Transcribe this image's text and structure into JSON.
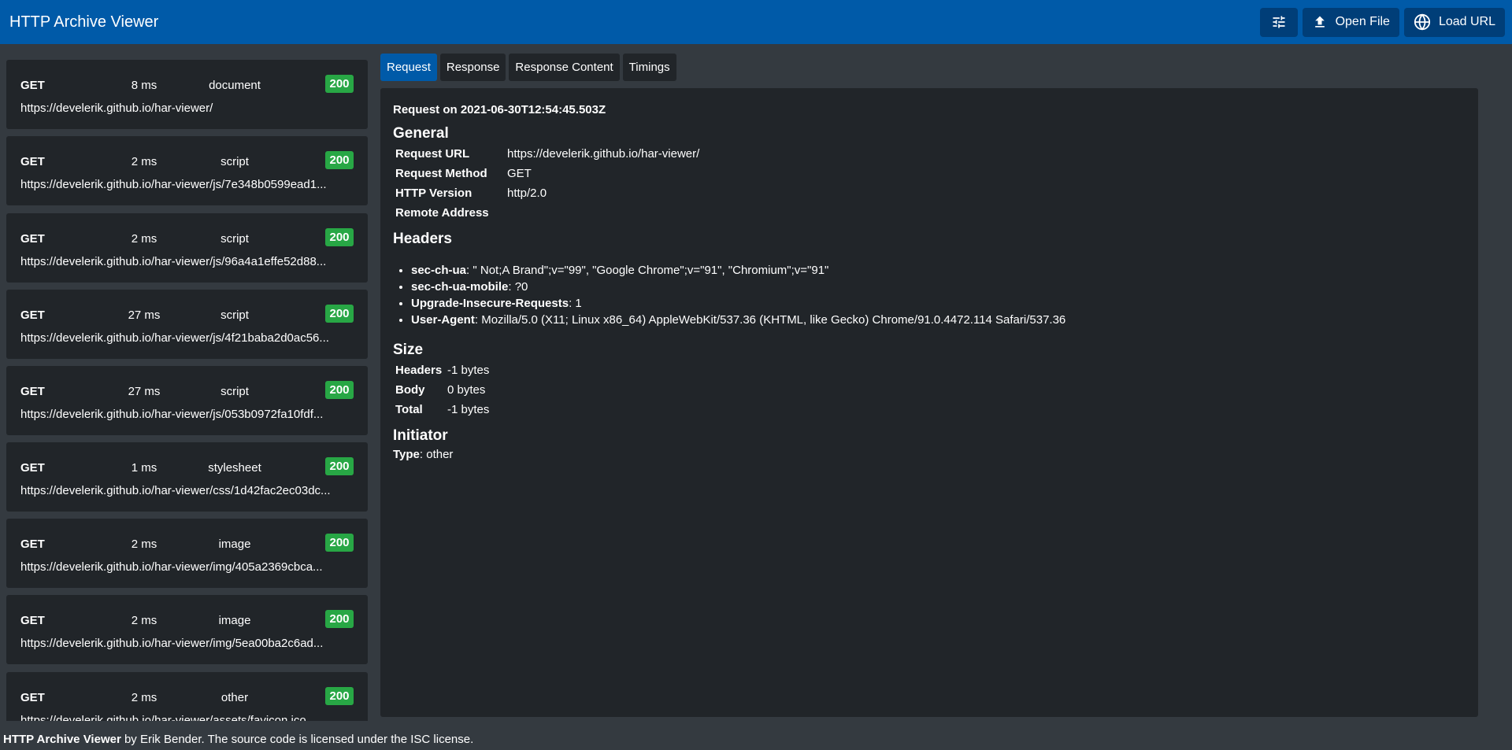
{
  "header": {
    "title": "HTTP Archive Viewer",
    "open_file_label": "Open File",
    "load_url_label": "Load URL"
  },
  "requests": [
    {
      "method": "GET",
      "time": "8 ms",
      "type": "document",
      "status": "200",
      "url": "https://develerik.github.io/har-viewer/"
    },
    {
      "method": "GET",
      "time": "2 ms",
      "type": "script",
      "status": "200",
      "url": "https://develerik.github.io/har-viewer/js/7e348b0599ead1..."
    },
    {
      "method": "GET",
      "time": "2 ms",
      "type": "script",
      "status": "200",
      "url": "https://develerik.github.io/har-viewer/js/96a4a1effe52d88..."
    },
    {
      "method": "GET",
      "time": "27 ms",
      "type": "script",
      "status": "200",
      "url": "https://develerik.github.io/har-viewer/js/4f21baba2d0ac56..."
    },
    {
      "method": "GET",
      "time": "27 ms",
      "type": "script",
      "status": "200",
      "url": "https://develerik.github.io/har-viewer/js/053b0972fa10fdf..."
    },
    {
      "method": "GET",
      "time": "1 ms",
      "type": "stylesheet",
      "status": "200",
      "url": "https://develerik.github.io/har-viewer/css/1d42fac2ec03dc..."
    },
    {
      "method": "GET",
      "time": "2 ms",
      "type": "image",
      "status": "200",
      "url": "https://develerik.github.io/har-viewer/img/405a2369cbca..."
    },
    {
      "method": "GET",
      "time": "2 ms",
      "type": "image",
      "status": "200",
      "url": "https://develerik.github.io/har-viewer/img/5ea00ba2c6ad..."
    },
    {
      "method": "GET",
      "time": "2 ms",
      "type": "other",
      "status": "200",
      "url": "https://develerik.github.io/har-viewer/assets/favicon.ico"
    }
  ],
  "tabs": [
    "Request",
    "Response",
    "Response Content",
    "Timings"
  ],
  "detail": {
    "request_on": "Request on 2021-06-30T12:54:45.503Z",
    "general_title": "General",
    "general": [
      {
        "key": "Request URL",
        "value": "https://develerik.github.io/har-viewer/"
      },
      {
        "key": "Request Method",
        "value": "GET"
      },
      {
        "key": "HTTP Version",
        "value": "http/2.0"
      },
      {
        "key": "Remote Address",
        "value": ""
      }
    ],
    "headers_title": "Headers",
    "headers": [
      {
        "key": "sec-ch-ua",
        "value": ": \" Not;A Brand\";v=\"99\", \"Google Chrome\";v=\"91\", \"Chromium\";v=\"91\""
      },
      {
        "key": "sec-ch-ua-mobile",
        "value": ": ?0"
      },
      {
        "key": "Upgrade-Insecure-Requests",
        "value": ": 1"
      },
      {
        "key": "User-Agent",
        "value": ": Mozilla/5.0 (X11; Linux x86_64) AppleWebKit/537.36 (KHTML, like Gecko) Chrome/91.0.4472.114 Safari/537.36"
      }
    ],
    "size_title": "Size",
    "size": [
      {
        "key": "Headers",
        "value": "-1 bytes"
      },
      {
        "key": "Body",
        "value": "0 bytes"
      },
      {
        "key": "Total",
        "value": "-1 bytes"
      }
    ],
    "initiator_title": "Initiator",
    "initiator_key": "Type",
    "initiator_value": ": other"
  },
  "footer": {
    "app_name": "HTTP Archive Viewer",
    "text": " by Erik Bender. The source code is licensed under the ISC license."
  },
  "colors": {
    "header_bg": "#005aa8",
    "status_ok": "#28a745",
    "panel_bg": "#212529",
    "page_bg": "#343a40"
  }
}
